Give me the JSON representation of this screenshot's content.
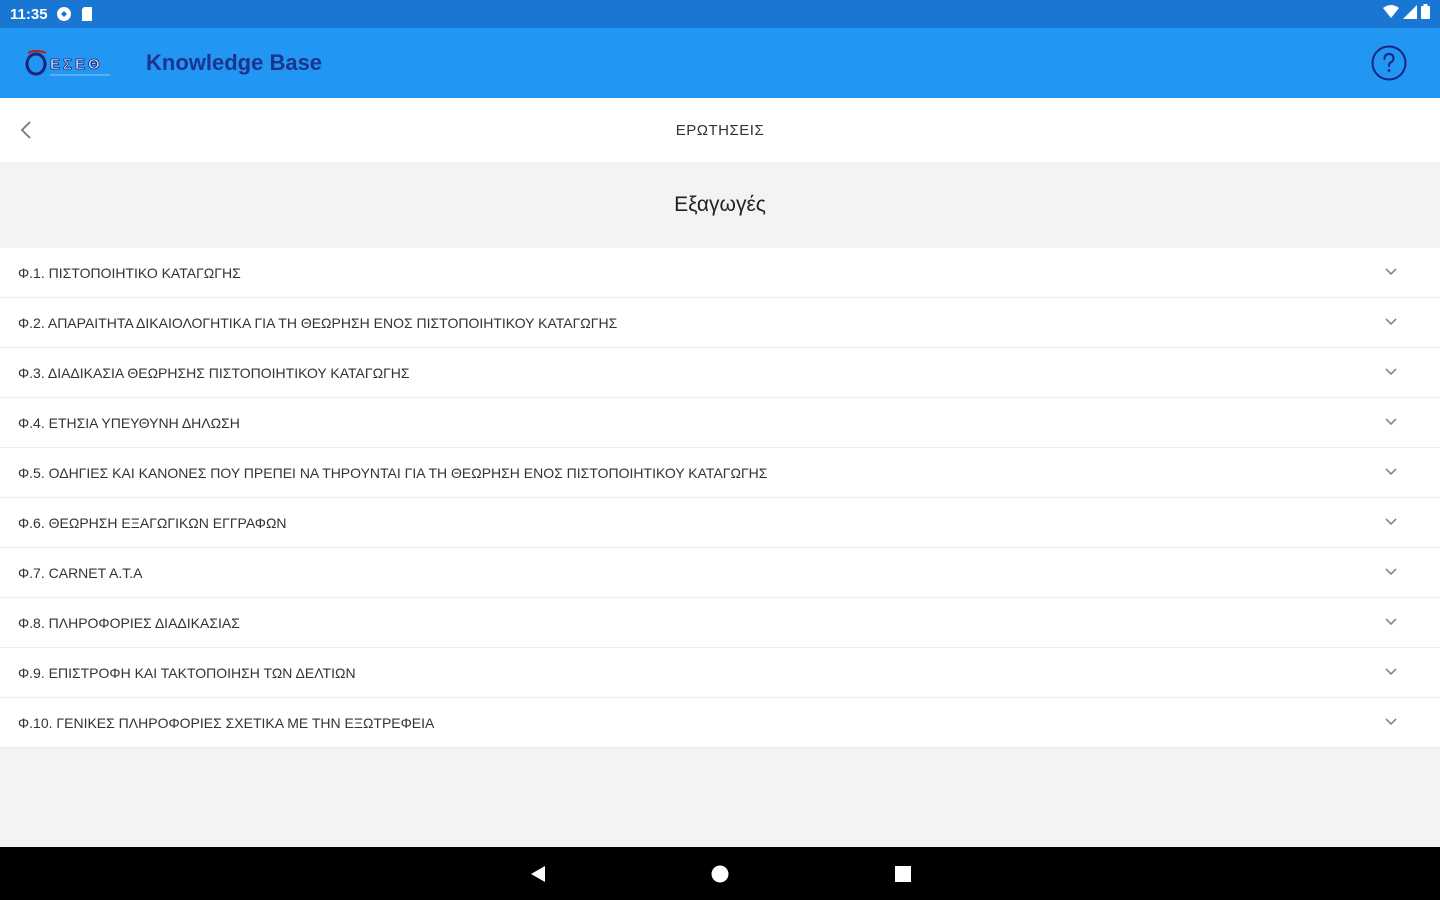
{
  "status_bar": {
    "time": "11:35",
    "icons": [
      "app-notification-icon",
      "sd-card-icon",
      "wifi-icon",
      "signal-icon",
      "battery-icon"
    ]
  },
  "app_bar": {
    "logo_name": "logo-eseo",
    "logo_text": "ΕΣΕΘ",
    "title": "Knowledge Base",
    "help_icon": "help-icon"
  },
  "sub_header": {
    "back_icon": "chevron-left-icon",
    "title": "ΕΡΩΤΗΣΕΙΣ"
  },
  "section": {
    "title": "Εξαγωγές"
  },
  "faq_items": [
    {
      "label": "Φ.1.  ΠΙΣΤΟΠΟΙΗΤΙΚΟ ΚΑΤΑΓΩΓΗΣ"
    },
    {
      "label": "Φ.2.  ΑΠΑΡΑΙΤΗΤΑ ΔΙΚΑΙΟΛΟΓΗΤΙΚΑ ΓΙΑ ΤΗ ΘΕΩΡΗΣΗ ΕΝΟΣ ΠΙΣΤΟΠΟΙΗΤΙΚΟΥ ΚΑΤΑΓΩΓΗΣ"
    },
    {
      "label": "Φ.3.  ΔΙΑΔΙΚΑΣΙΑ ΘΕΩΡΗΣΗΣ ΠΙΣΤΟΠΟΙΗΤΙΚΟΥ ΚΑΤΑΓΩΓΗΣ"
    },
    {
      "label": "Φ.4.  ΕΤΗΣΙΑ ΥΠΕΥΘΥΝΗ ΔΗΛΩΣΗ"
    },
    {
      "label": "Φ.5.  ΟΔΗΓΙΕΣ ΚΑΙ ΚΑΝΟΝΕΣ ΠΟΥ ΠΡΕΠΕΙ ΝΑ ΤΗΡΟΥΝΤΑΙ ΓΙΑ ΤΗ ΘΕΩΡΗΣΗ ΕΝΟΣ ΠΙΣΤΟΠΟΙΗΤΙΚΟΥ ΚΑΤΑΓΩΓΗΣ"
    },
    {
      "label": "Φ.6.  ΘΕΩΡΗΣΗ ΕΞΑΓΩΓΙΚΩΝ ΕΓΓΡΑΦΩΝ"
    },
    {
      "label": "Φ.7.  CARNET A.T.A"
    },
    {
      "label": "Φ.8.  ΠΛΗΡΟΦΟΡΙΕΣ ΔΙΑΔΙΚΑΣΙΑΣ"
    },
    {
      "label": "Φ.9.  ΕΠΙΣΤΡΟΦΗ ΚΑΙ ΤΑΚΤΟΠΟΙΗΣΗ ΤΩΝ ΔΕΛΤΙΩΝ"
    },
    {
      "label": "Φ.10.  ΓΕΝΙΚΕΣ ΠΛΗΡΟΦΟΡΙΕΣ ΣΧΕΤΙΚΑ ΜΕ ΤΗΝ ΕΞΩΤΡΕΦΕΙΑ"
    }
  ],
  "nav_bar": {
    "back": "nav-back-icon",
    "home": "nav-home-icon",
    "recents": "nav-recents-icon"
  },
  "colors": {
    "status_bar": "#1976d2",
    "app_bar": "#2196f3",
    "title_text": "#1a237e",
    "background": "#f2f3f4",
    "nav_bar": "#000000"
  }
}
